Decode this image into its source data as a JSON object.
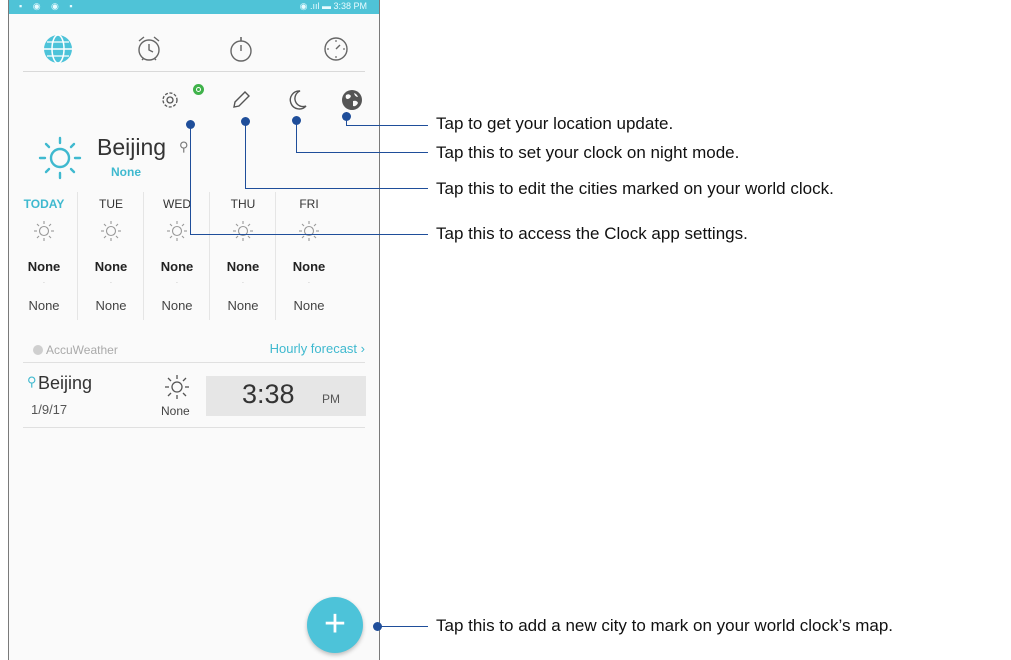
{
  "status_bar": {
    "left": "▪ ◉ ◉ ▪",
    "right": "◉ .ııl ▬ 3:38 PM"
  },
  "tabs": [
    {
      "icon": "world-clock-icon"
    },
    {
      "icon": "alarm-icon"
    },
    {
      "icon": "stopwatch-icon"
    },
    {
      "icon": "timer-icon"
    }
  ],
  "toolbar": [
    {
      "icon": "gear-icon"
    },
    {
      "icon": "pencil-icon"
    },
    {
      "icon": "moon-icon"
    },
    {
      "icon": "globe-icon"
    }
  ],
  "current": {
    "city": "Beijing",
    "condition": "None"
  },
  "forecast": [
    {
      "day": "TODAY",
      "high": "None",
      "low": "None"
    },
    {
      "day": "TUE",
      "high": "None",
      "low": "None"
    },
    {
      "day": "WED",
      "high": "None",
      "low": "None"
    },
    {
      "day": "THU",
      "high": "None",
      "low": "None"
    },
    {
      "day": "FRI",
      "high": "None",
      "low": "None"
    }
  ],
  "accuweather": "AccuWeather",
  "hourly_forecast": "Hourly forecast ›",
  "city_row": {
    "city": "Beijing",
    "date": "1/9/17",
    "condition": "None",
    "time": "3:38",
    "ampm": "PM"
  },
  "fab_label": "+",
  "callouts": {
    "location": "Tap to get your location update.",
    "night": "Tap this to set your clock on night mode.",
    "edit": "Tap this to edit the cities marked on your world clock.",
    "settings": "Tap this to access the Clock app settings.",
    "add": "Tap this to add a new city to mark on your world clock’s map."
  },
  "colors": {
    "accent": "#4dc3d9",
    "callout": "#1f4e9a",
    "sync": "#3fb24a"
  }
}
